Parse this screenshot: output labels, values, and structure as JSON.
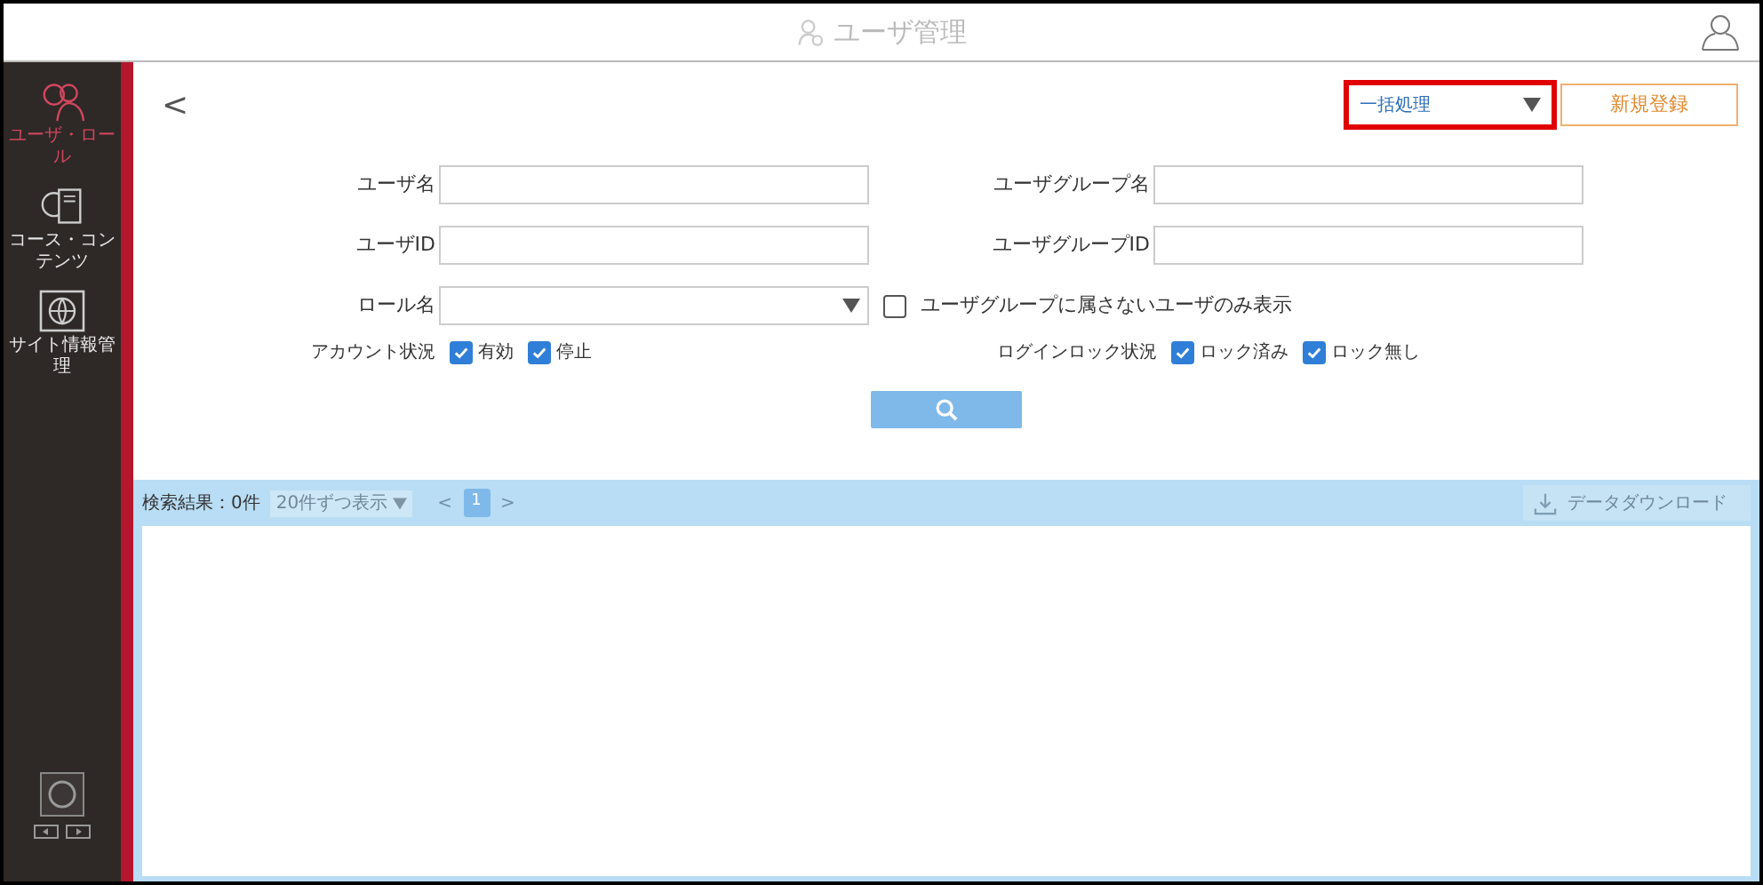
{
  "header": {
    "title": "ユーザ管理"
  },
  "sidebar": {
    "items": [
      {
        "label": "ユーザ・ロール",
        "selected": true
      },
      {
        "label": "コース・コンテンツ",
        "selected": false
      },
      {
        "label": "サイト情報管理",
        "selected": false
      }
    ]
  },
  "toolbar": {
    "back": "<",
    "bulk_select": {
      "value": "一括処理",
      "highlighted": true
    },
    "new_button": "新規登録"
  },
  "form": {
    "fields": [
      {
        "label": "ユーザ名",
        "kind": "text"
      },
      {
        "label": "ユーザグループ名",
        "kind": "text"
      },
      {
        "label": "ユーザID",
        "kind": "text"
      },
      {
        "label": "ユーザグループID",
        "kind": "text"
      },
      {
        "label": "ロール名",
        "kind": "select"
      },
      {
        "label": "ユーザグループに属さないユーザのみ表示",
        "kind": "checkbox",
        "checked": false
      }
    ],
    "status_groups": [
      {
        "label": "アカウント状況",
        "options": [
          {
            "label": "有効",
            "checked": true
          },
          {
            "label": "停止",
            "checked": true
          }
        ]
      },
      {
        "label": "ログインロック状況",
        "options": [
          {
            "label": "ロック済み",
            "checked": true
          },
          {
            "label": "ロック無し",
            "checked": true
          }
        ]
      }
    ]
  },
  "results": {
    "count": "検索結果：0件",
    "page_size": "20件ずつ表示",
    "prev": "<",
    "pages": [
      {
        "label": "1",
        "selected": true
      }
    ],
    "next": ">",
    "download": "データダウンロード"
  }
}
